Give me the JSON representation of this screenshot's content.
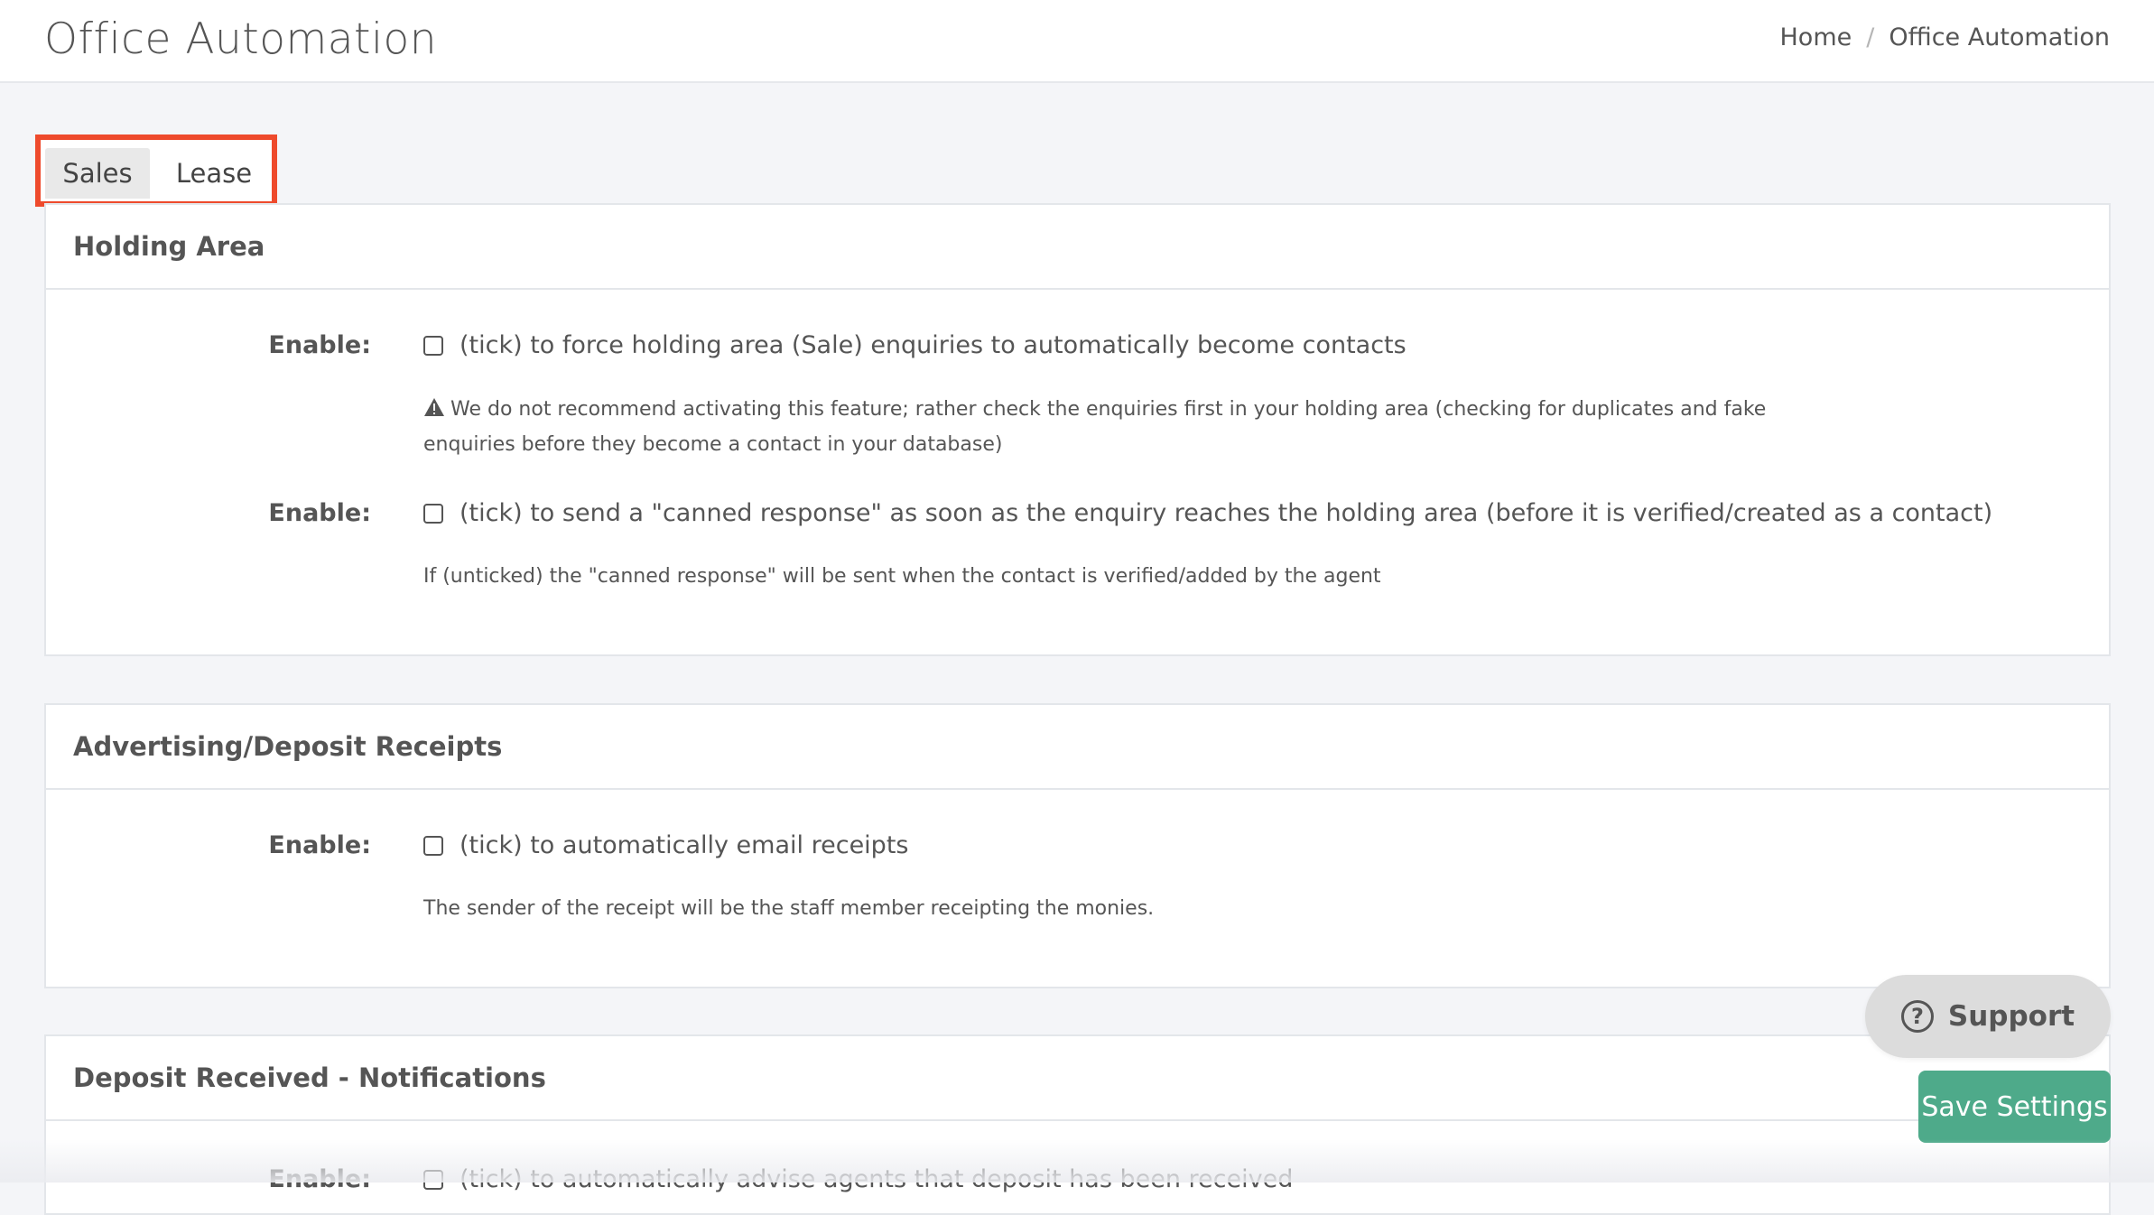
{
  "header": {
    "title": "Office Automation",
    "breadcrumb": {
      "home": "Home",
      "separator": "/",
      "current": "Office Automation"
    }
  },
  "tabs": [
    {
      "label": "Sales",
      "active": true
    },
    {
      "label": "Lease",
      "active": false
    }
  ],
  "sections": {
    "holding_area": {
      "title": "Holding Area",
      "option1": {
        "label": "Enable:",
        "text": "(tick) to force holding area (Sale) enquiries to automatically become contacts",
        "note_line1": "We do not recommend activating this feature; rather check the enquiries first in your holding area (checking for duplicates and fake",
        "note_line2": "enquiries before they become a contact in your database)"
      },
      "option2": {
        "label": "Enable:",
        "text": "(tick) to send a \"canned response\" as soon as the enquiry reaches the holding area (before it is verified/created as a contact)",
        "note": "If (unticked) the \"canned response\" will be sent when the contact is verified/added by the agent"
      }
    },
    "advertising": {
      "title": "Advertising/Deposit Receipts",
      "option1": {
        "label": "Enable:",
        "text": "(tick) to automatically email receipts",
        "note": "The sender of the receipt will be the staff member receipting the monies."
      }
    },
    "deposit_received": {
      "title": "Deposit Received - Notifications",
      "option1": {
        "label": "Enable:",
        "text": "(tick) to automatically advise agents that deposit has been received"
      }
    }
  },
  "buttons": {
    "support": "Support",
    "save": "Save Settings"
  },
  "colors": {
    "highlight": "#ee4a2c",
    "save_button": "#4eaa8a",
    "support_button": "#dcdcdc"
  }
}
